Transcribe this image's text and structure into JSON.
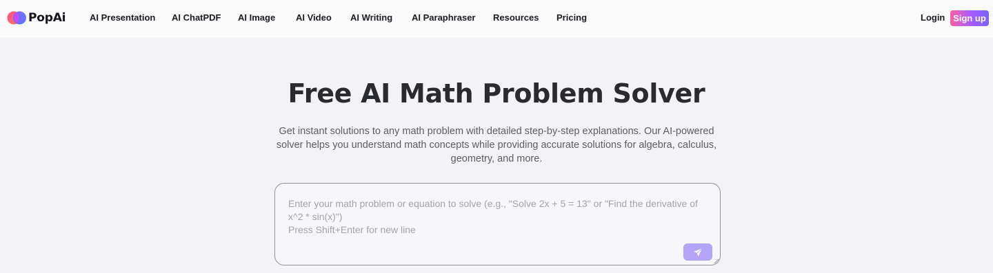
{
  "brand": {
    "name": "PopAi",
    "accent_gradient": [
      "#ff5fa0",
      "#a35cff",
      "#7a63ff"
    ]
  },
  "nav": {
    "items": [
      {
        "label": "AI Presentation"
      },
      {
        "label": "AI ChatPDF"
      },
      {
        "label": "AI Image"
      },
      {
        "label": "AI Video"
      },
      {
        "label": "AI Writing"
      },
      {
        "label": "AI Paraphraser"
      },
      {
        "label": "Resources"
      },
      {
        "label": "Pricing"
      }
    ],
    "login_label": "Login",
    "signup_label": "Sign up"
  },
  "hero": {
    "title": "Free AI Math Problem Solver",
    "subtitle": "Get instant solutions to any math problem with detailed step-by-step explanations. Our AI-powered solver helps you understand math concepts while providing accurate solutions for algebra, calculus, geometry, and more."
  },
  "input": {
    "value": "",
    "placeholder": "Enter your math problem or equation to solve (e.g., \"Solve 2x + 5 = 13\" or \"Find the derivative of x^2 * sin(x)\")\nPress Shift+Enter for new line",
    "send_icon": "paper-plane-icon",
    "send_button_color": "#b3a4f7"
  }
}
